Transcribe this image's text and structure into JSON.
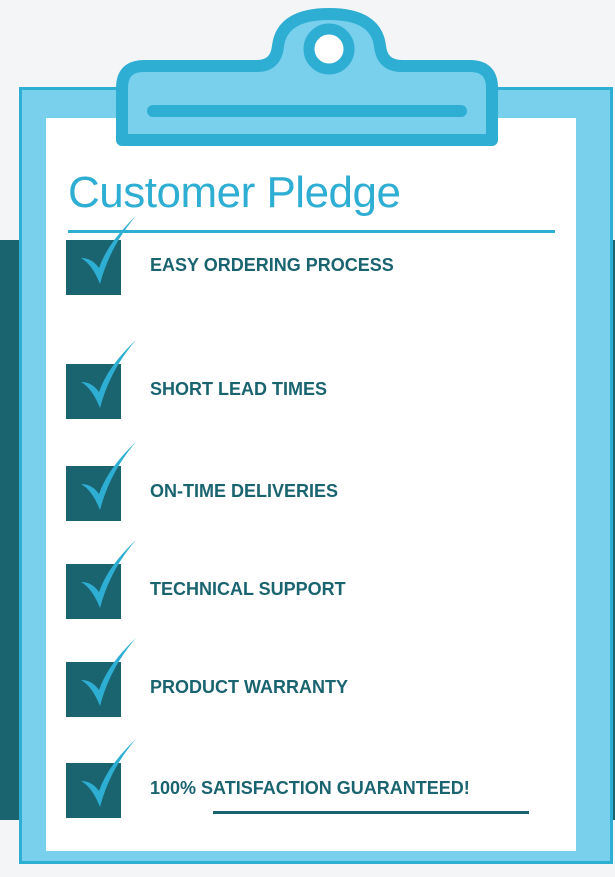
{
  "title": "Customer Pledge",
  "items": [
    {
      "label": "EASY ORDERING PROCESS"
    },
    {
      "label": "SHORT LEAD TIMES"
    },
    {
      "label": "ON-TIME DELIVERIES"
    },
    {
      "label": "TECHNICAL SUPPORT"
    },
    {
      "label": "PRODUCT WARRANTY"
    },
    {
      "label": "100% SATISFACTION GUARANTEED!"
    }
  ],
  "icons": {
    "item_marker": "checkmark-icon",
    "clip": "clipboard-clip-icon"
  },
  "colors": {
    "accent": "#2eaed2",
    "board": "#79d0ed",
    "dark_teal": "#1a6470",
    "background": "#f4f5f7",
    "paper": "#ffffff"
  }
}
